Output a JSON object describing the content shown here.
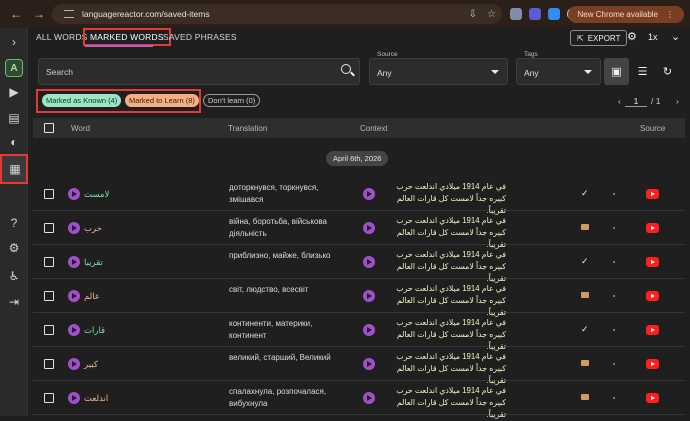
{
  "browser": {
    "url": "languagereactor.com/saved-items",
    "update_label": "New Chrome available"
  },
  "sidebar": {
    "avatar_letter": "A"
  },
  "tabs": [
    {
      "label": "ALL WORDS"
    },
    {
      "label": "MARKED WORDS"
    },
    {
      "label": "SAVED PHRASES"
    }
  ],
  "toolbar": {
    "export_label": "EXPORT",
    "speed_label": "1x"
  },
  "search": {
    "placeholder": "Search"
  },
  "filters": {
    "source": {
      "label": "Source",
      "value": "Any"
    },
    "tags": {
      "label": "Tags",
      "value": "Any"
    }
  },
  "chips": {
    "known": "Marked as Known (4)",
    "learn": "Marked to Learn (8)",
    "dont": "Don't learn (0)"
  },
  "pager": {
    "page": "1",
    "total": "/ 1"
  },
  "table": {
    "headers": {
      "word": "Word",
      "translation": "Translation",
      "context": "Context",
      "source": "Source"
    },
    "date_group": "April 6th, 2026",
    "context_sentence": "في عام 1914 ميلادي اندلعت حرب كبيره جداً لامست كل قارات العالم تقريباً.",
    "rows": [
      {
        "word": "لامست",
        "translation": "доторкнувся, торкнувся, змішався",
        "status": "known"
      },
      {
        "word": "حرب",
        "translation": "війна, боротьба, військова діяльність",
        "status": "learn"
      },
      {
        "word": "تقريبا",
        "translation": "приблизно, майже, близько",
        "status": "known"
      },
      {
        "word": "عالم",
        "translation": "світ, людство, всесвіт",
        "status": "learn"
      },
      {
        "word": "قارات",
        "translation": "континенти, материки, континент",
        "status": "known"
      },
      {
        "word": "كبير",
        "translation": "великий, старший, Великий",
        "status": "learn"
      },
      {
        "word": "اندلعت",
        "translation": "спалахнула, розпочалася, вибухнула",
        "status": "learn"
      }
    ]
  }
}
